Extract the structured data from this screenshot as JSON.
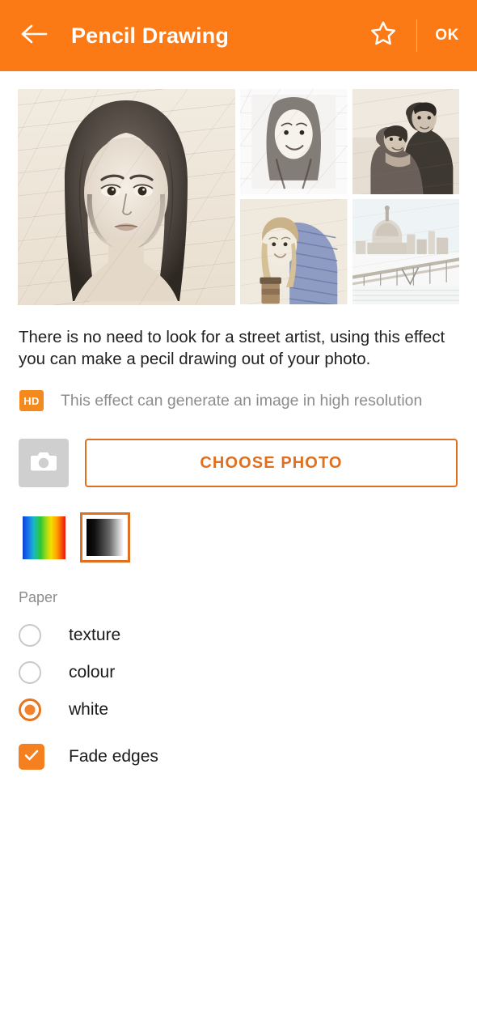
{
  "appbar": {
    "back_icon": "arrow-left-icon",
    "title": "Pencil Drawing",
    "star_icon": "star-outline-icon",
    "ok_label": "OK",
    "background_color": "#FB7A16",
    "text_color": "#FFFFFF"
  },
  "gallery": {
    "main": {
      "alt": "pencil-sketch-portrait-of-woman-with-long-dark-hair"
    },
    "thumbnails": [
      {
        "alt": "pencil-sketch-of-smiling-young-woman-outdoors"
      },
      {
        "alt": "pencil-sketch-of-couple-embracing"
      },
      {
        "alt": "pencil-sketch-of-blonde-woman-with-knitted-scarf-holding-coffee"
      },
      {
        "alt": "pencil-sketch-of-city-skyline-with-cathedral-and-bridge"
      }
    ]
  },
  "description": {
    "text": "There is no need to look for a street artist, using this effect you can make a pecil drawing out of your photo."
  },
  "hd_note": {
    "badge": "HD",
    "badge_color": "#F4891E",
    "text": "This effect can generate an image in high resolution",
    "text_color": "#8C8C8C"
  },
  "actions": {
    "camera_icon": "camera-icon",
    "camera_button_color": "#CFCFCF",
    "choose_photo_label": "CHOOSE PHOTO",
    "choose_photo_color": "#E0701F"
  },
  "swatches": [
    {
      "name": "colour-gradient-swatch",
      "selected": false
    },
    {
      "name": "grayscale-gradient-swatch",
      "selected": true
    }
  ],
  "paper": {
    "group_label": "Paper",
    "options": [
      {
        "label": "texture",
        "selected": false
      },
      {
        "label": "colour",
        "selected": false
      },
      {
        "label": "white",
        "selected": true
      }
    ]
  },
  "fade_edges": {
    "label": "Fade edges",
    "checked": true,
    "color": "#F4801F"
  }
}
